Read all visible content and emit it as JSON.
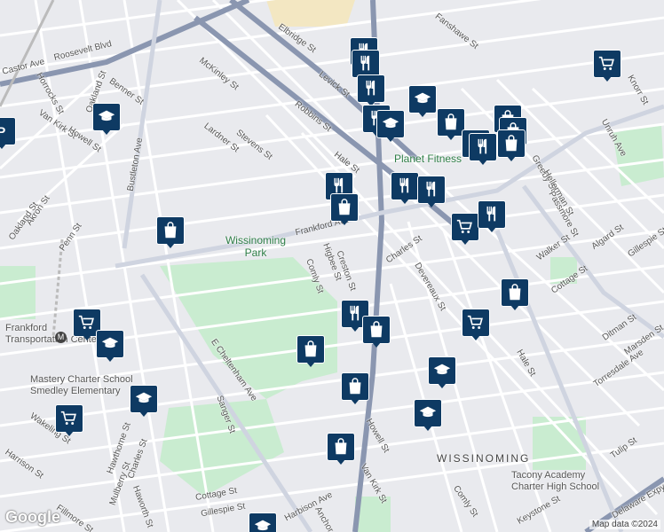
{
  "map": {
    "streets": [
      "Roosevelt Blvd",
      "Castor Ave",
      "Elbridge St",
      "Fanshawe St",
      "Horrocks St",
      "Oakland St",
      "Benner St",
      "Van Kirk St",
      "Howell St",
      "Bustleton Ave",
      "McKinley St",
      "Robbins St",
      "Levick St",
      "Stevens St",
      "Lardner St",
      "Hale St",
      "Greeby St",
      "Hellerman St",
      "Passmore St",
      "Unruh Ave",
      "Knorr St",
      "Akron St",
      "Oakland St",
      "Penn St",
      "Frankford Ave",
      "Walker St",
      "Algard St",
      "Gillespie St",
      "Charles St",
      "Higbee St",
      "Creston St",
      "Comly St",
      "Devereaux St",
      "Cottage St",
      "Ditman St",
      "Marsden St",
      "Torresdale Ave",
      "Hale St",
      "E Cheltenham Ave",
      "Sanger St",
      "Hawthorne St",
      "Mulberry St",
      "Charles St",
      "Haworth St",
      "Wakeling St",
      "Harrison St",
      "Cottage St",
      "Gillespie St",
      "Harbison Ave",
      "Anchor St",
      "Van Kirk St",
      "Howell St",
      "Tulip St",
      "Keystone St",
      "Delaware Expy",
      "Comly St",
      "Fillmore St"
    ],
    "park_label": "Wissinoming Park",
    "poi_label": "Planet Fitness",
    "neighborhood": "WISSINOMING",
    "station_label": "Frankford Transportation Center",
    "schools": [
      "Mastery Charter School Smedley Elementary",
      "Tacony Academy Charter High School"
    ],
    "attribution": "Map data ©2024",
    "logo": "Google"
  },
  "colors": {
    "pin": "#0e3a63",
    "park": "#c9ecd0",
    "water": "#e9eaee",
    "road": "#ffffff",
    "major": "#8a96b0"
  }
}
